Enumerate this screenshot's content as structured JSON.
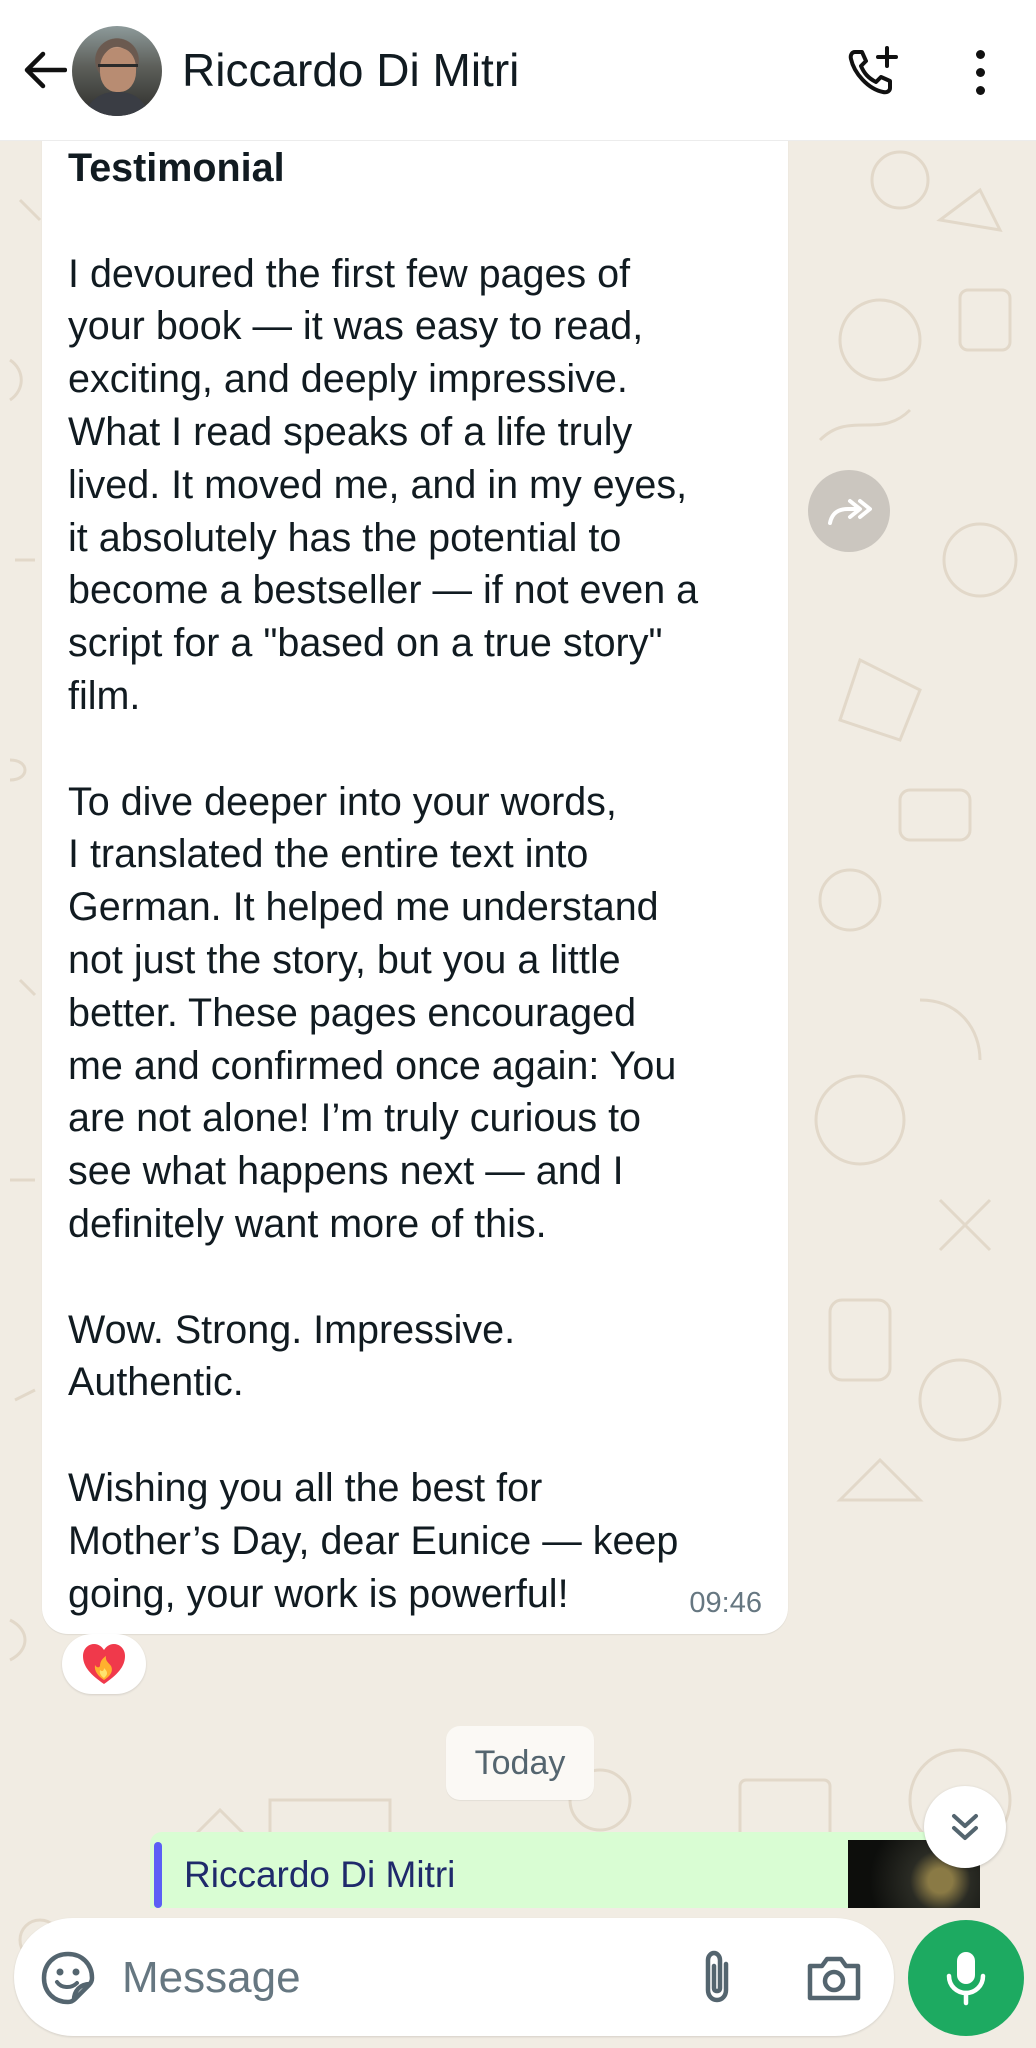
{
  "header": {
    "contact_name": "Riccardo Di Mitri",
    "back_icon": "arrow-left-icon",
    "call_icon": "phone-add-icon",
    "menu_icon": "more-vertical-icon"
  },
  "message": {
    "title": "Testimonial",
    "body": "\nI devoured the first few pages of\nyour book — it was easy to read,\nexciting, and deeply impressive.\nWhat I read speaks of a life truly\nlived. It moved me, and in my eyes,\nit absolutely has the potential to\nbecome a bestseller — if not even a\nscript for a \"based on a true story\"\nfilm.\n\nTo dive deeper into your words,\nI translated the entire text into\nGerman. It helped me understand\nnot just the story, but you a little\nbetter. These pages encouraged\nme and confirmed once again: You\nare not alone! I’m truly curious to\nsee what happens next — and I\ndefinitely want more of this.\n\nWow. Strong. Impressive.\nAuthentic.\n\nWishing you all the best for\nMother’s Day, dear Eunice — keep\ngoing, your work is powerful!",
    "time": "09:46",
    "reaction": "❤️‍🔥"
  },
  "date_separator": "Today",
  "reply_preview": {
    "sender": "Riccardo Di Mitri"
  },
  "input": {
    "placeholder": "Message"
  },
  "colors": {
    "accent_green": "#1daa61",
    "chat_background": "#f1ece3",
    "reply_background": "#d9fdd3",
    "reply_bar": "#5b5ff5"
  },
  "icons": [
    "arrow-left-icon",
    "phone-add-icon",
    "more-vertical-icon",
    "forward-icon",
    "chevrons-down-icon",
    "sticker-icon",
    "paperclip-icon",
    "camera-icon",
    "mic-icon"
  ]
}
